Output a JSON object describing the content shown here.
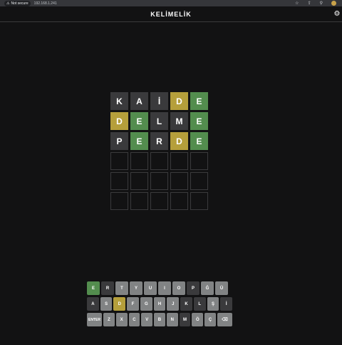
{
  "browser": {
    "secure_label": "Not secure",
    "url": "192.168.1.241"
  },
  "app": {
    "title": "KELİMELİK"
  },
  "board": [
    [
      {
        "l": "K",
        "s": "absent"
      },
      {
        "l": "A",
        "s": "absent"
      },
      {
        "l": "İ",
        "s": "absent"
      },
      {
        "l": "D",
        "s": "present"
      },
      {
        "l": "E",
        "s": "correct"
      }
    ],
    [
      {
        "l": "D",
        "s": "present"
      },
      {
        "l": "E",
        "s": "correct"
      },
      {
        "l": "L",
        "s": "absent"
      },
      {
        "l": "M",
        "s": "absent"
      },
      {
        "l": "E",
        "s": "correct"
      }
    ],
    [
      {
        "l": "P",
        "s": "absent"
      },
      {
        "l": "E",
        "s": "correct"
      },
      {
        "l": "R",
        "s": "absent"
      },
      {
        "l": "D",
        "s": "present"
      },
      {
        "l": "E",
        "s": "correct"
      }
    ],
    [
      {
        "l": "",
        "s": "empty"
      },
      {
        "l": "",
        "s": "empty"
      },
      {
        "l": "",
        "s": "empty"
      },
      {
        "l": "",
        "s": "empty"
      },
      {
        "l": "",
        "s": "empty"
      }
    ],
    [
      {
        "l": "",
        "s": "empty"
      },
      {
        "l": "",
        "s": "empty"
      },
      {
        "l": "",
        "s": "empty"
      },
      {
        "l": "",
        "s": "empty"
      },
      {
        "l": "",
        "s": "empty"
      }
    ],
    [
      {
        "l": "",
        "s": "empty"
      },
      {
        "l": "",
        "s": "empty"
      },
      {
        "l": "",
        "s": "empty"
      },
      {
        "l": "",
        "s": "empty"
      },
      {
        "l": "",
        "s": "empty"
      }
    ]
  ],
  "keyboard": [
    [
      {
        "k": "E",
        "s": "correct"
      },
      {
        "k": "R",
        "s": "absent"
      },
      {
        "k": "T",
        "s": ""
      },
      {
        "k": "Y",
        "s": ""
      },
      {
        "k": "U",
        "s": ""
      },
      {
        "k": "I",
        "s": ""
      },
      {
        "k": "O",
        "s": ""
      },
      {
        "k": "P",
        "s": "absent"
      },
      {
        "k": "Ğ",
        "s": ""
      },
      {
        "k": "Ü",
        "s": ""
      }
    ],
    [
      {
        "k": "A",
        "s": "absent"
      },
      {
        "k": "S",
        "s": ""
      },
      {
        "k": "D",
        "s": "present"
      },
      {
        "k": "F",
        "s": ""
      },
      {
        "k": "G",
        "s": ""
      },
      {
        "k": "H",
        "s": ""
      },
      {
        "k": "J",
        "s": ""
      },
      {
        "k": "K",
        "s": "absent"
      },
      {
        "k": "L",
        "s": "absent"
      },
      {
        "k": "Ş",
        "s": ""
      },
      {
        "k": "İ",
        "s": "absent"
      }
    ],
    [
      {
        "k": "ENTER",
        "s": "",
        "wide": true
      },
      {
        "k": "Z",
        "s": ""
      },
      {
        "k": "X",
        "s": ""
      },
      {
        "k": "C",
        "s": ""
      },
      {
        "k": "V",
        "s": ""
      },
      {
        "k": "B",
        "s": ""
      },
      {
        "k": "N",
        "s": ""
      },
      {
        "k": "M",
        "s": "absent"
      },
      {
        "k": "Ö",
        "s": ""
      },
      {
        "k": "Ç",
        "s": ""
      },
      {
        "k": "⌫",
        "s": "",
        "back": true
      }
    ]
  ],
  "colors": {
    "correct": "#538d4e",
    "present": "#b59f3b",
    "absent": "#3a3a3c",
    "key_default": "#818384",
    "background": "#121213"
  },
  "icons": {
    "settings": "gear-icon",
    "warning": "warning-icon",
    "backspace": "backspace-icon"
  }
}
